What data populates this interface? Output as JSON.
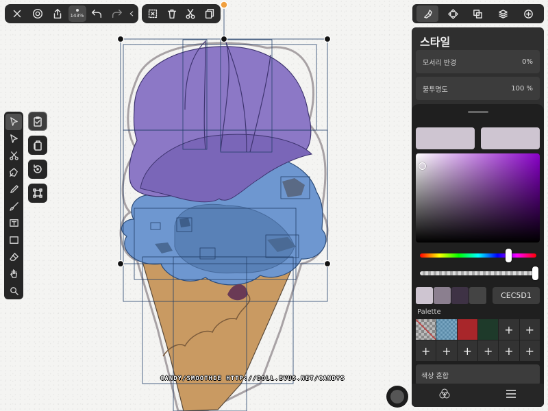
{
  "top_toolbar": {
    "zoom_label": "143%"
  },
  "panel": {
    "title": "스타일",
    "corner_radius": {
      "label": "모서리 반경",
      "value": "0%"
    },
    "opacity": {
      "label": "불투명도",
      "value": "100 %"
    },
    "colors": {
      "fill_swatch": "#CEC5D1",
      "stroke_swatch": "#CEC5D1",
      "history": [
        "#CEC5D1",
        "#8B7F8F",
        "#3E3245",
        "#444444"
      ],
      "hue_fraction": 0.76,
      "alpha_fraction": 1.0
    },
    "hex_value": "CEC5D1",
    "palette_label": "Palette",
    "palette": [
      {
        "type": "transparent"
      },
      {
        "type": "checker"
      },
      {
        "type": "color",
        "color": "#A8262A"
      },
      {
        "type": "color",
        "color": "#1E3A2A"
      },
      {
        "type": "add",
        "label": "+"
      },
      {
        "type": "add",
        "label": "+"
      },
      {
        "type": "add",
        "label": "+"
      },
      {
        "type": "add",
        "label": "+"
      },
      {
        "type": "add",
        "label": "+"
      },
      {
        "type": "add",
        "label": "+"
      },
      {
        "type": "add",
        "label": "+"
      },
      {
        "type": "add",
        "label": "+"
      }
    ],
    "color_mix_label": "색상 혼합"
  },
  "canvas": {
    "watermark": "CANDY/SMOOTHIE HTTP://DOLL.EVUS.NET/CANDYS",
    "scoop_top_color": "#8C78C6",
    "scoop_mid_color": "#6E97D0",
    "cone_color": "#C99A62",
    "selection_color": "#24406A"
  }
}
